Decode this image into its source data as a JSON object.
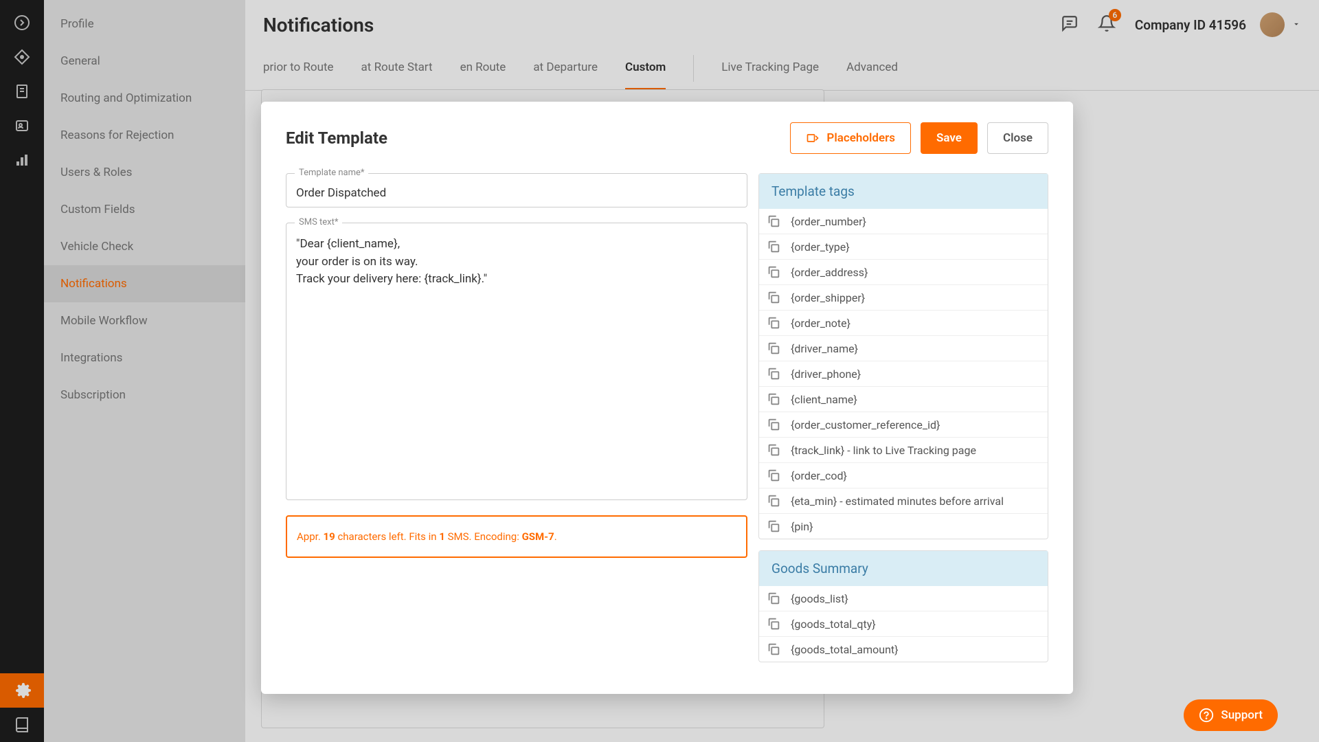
{
  "header": {
    "page_title": "Notifications",
    "company_id": "Company ID 41596",
    "notification_badge": "6"
  },
  "sidebar": {
    "items": [
      {
        "label": "Profile"
      },
      {
        "label": "General"
      },
      {
        "label": "Routing and Optimization"
      },
      {
        "label": "Reasons for Rejection"
      },
      {
        "label": "Users & Roles"
      },
      {
        "label": "Custom Fields"
      },
      {
        "label": "Vehicle Check"
      },
      {
        "label": "Notifications",
        "active": true
      },
      {
        "label": "Mobile Workflow"
      },
      {
        "label": "Integrations"
      },
      {
        "label": "Subscription"
      }
    ]
  },
  "tabs": [
    {
      "label": "prior to Route"
    },
    {
      "label": "at Route Start"
    },
    {
      "label": "en Route"
    },
    {
      "label": "at Departure"
    },
    {
      "label": "Custom",
      "active": true
    },
    {
      "label": "Live Tracking Page"
    },
    {
      "label": "Advanced"
    }
  ],
  "modal": {
    "title": "Edit Template",
    "buttons": {
      "placeholders": "Placeholders",
      "save": "Save",
      "close": "Close"
    },
    "template_name_label": "Template name*",
    "template_name_value": "Order Dispatched",
    "sms_text_label": "SMS text*",
    "sms_text_value": "\"Dear {client_name},\nyour order is on its way.\nTrack your delivery here: {track_link}.\"",
    "sms_info": {
      "prefix": "Appr. ",
      "chars_left": "19",
      "chars_left_suffix": " characters left. Fits in ",
      "sms_count": "1",
      "sms_count_suffix": " SMS. Encoding: ",
      "encoding": "GSM-7",
      "suffix": "."
    },
    "template_tags_header": "Template tags",
    "template_tags": [
      "{order_number}",
      "{order_type}",
      "{order_address}",
      "{order_shipper}",
      "{order_note}",
      "{driver_name}",
      "{driver_phone}",
      "{client_name}",
      "{order_customer_reference_id}",
      "{track_link} - link to Live Tracking page",
      "{order_cod}",
      "{eta_min} - estimated minutes before arrival",
      "{pin}"
    ],
    "goods_summary_header": "Goods Summary",
    "goods_summary_tags": [
      "{goods_list}",
      "{goods_total_qty}",
      "{goods_total_amount}"
    ]
  },
  "support_label": "Support"
}
